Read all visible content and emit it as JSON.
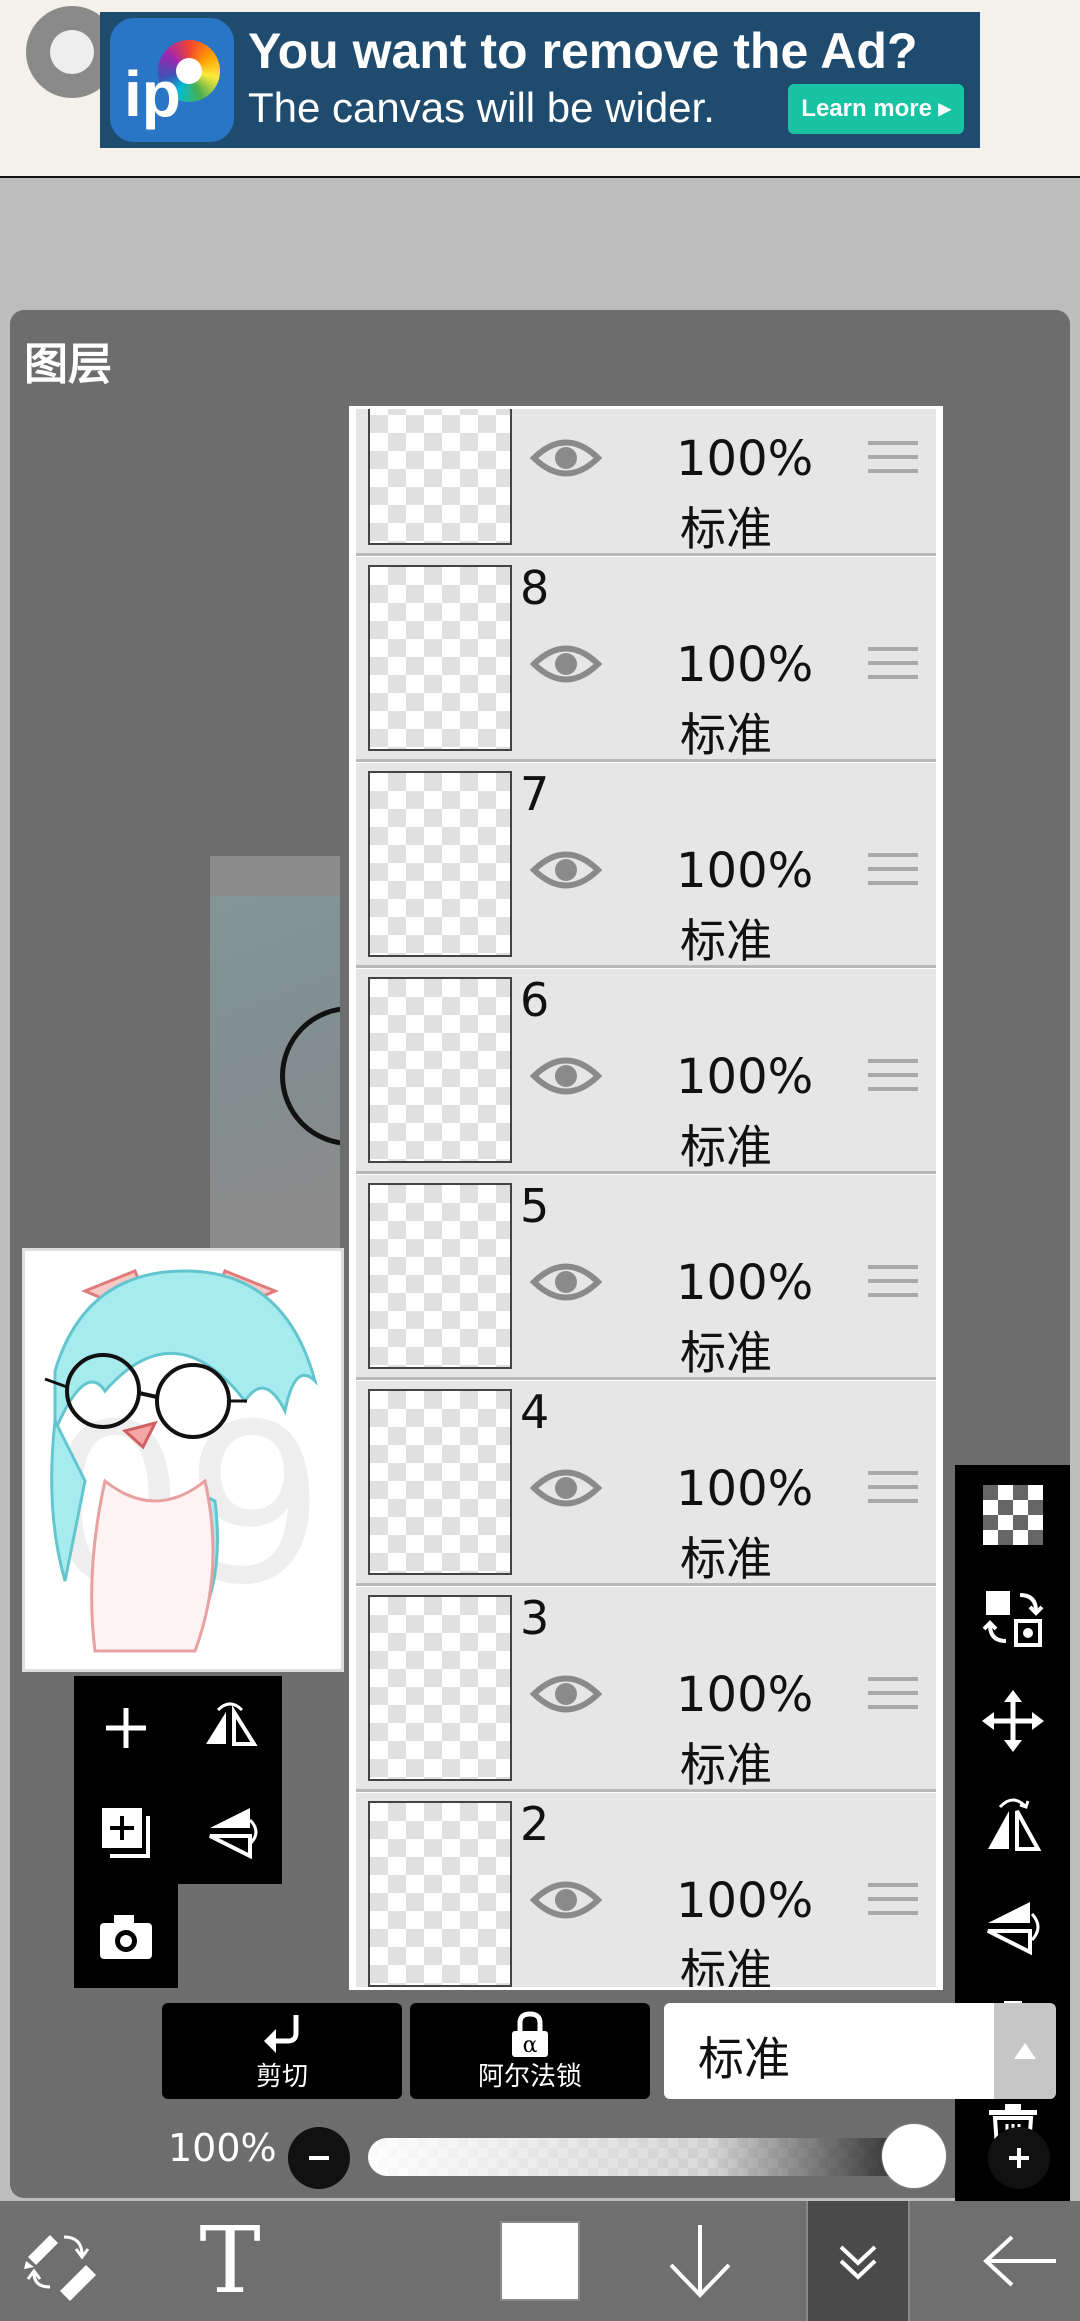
{
  "ad": {
    "title": "You want to remove the Ad?",
    "subtitle": "The canvas will be wider.",
    "cta": "Learn more ▸",
    "logo_text": "ip"
  },
  "panel": {
    "title": "图层"
  },
  "layers": [
    {
      "number": "",
      "opacity": "100%",
      "mode": "标准",
      "visible": true
    },
    {
      "number": "8",
      "opacity": "100%",
      "mode": "标准",
      "visible": true
    },
    {
      "number": "7",
      "opacity": "100%",
      "mode": "标准",
      "visible": true
    },
    {
      "number": "6",
      "opacity": "100%",
      "mode": "标准",
      "visible": true
    },
    {
      "number": "5",
      "opacity": "100%",
      "mode": "标准",
      "visible": true
    },
    {
      "number": "4",
      "opacity": "100%",
      "mode": "标准",
      "visible": true
    },
    {
      "number": "3",
      "opacity": "100%",
      "mode": "标准",
      "visible": true
    },
    {
      "number": "2",
      "opacity": "100%",
      "mode": "标准",
      "visible": true
    }
  ],
  "controls": {
    "clip_label": "剪切",
    "alpha_lock_label": "阿尔法锁",
    "blend_mode": "标准",
    "opacity_label": "100%",
    "opacity_value": 1.0
  },
  "icons": {
    "mini_tools": [
      "add-layer-icon",
      "flip-horizontal-icon",
      "duplicate-layer-icon",
      "flip-vertical-icon",
      "camera-icon"
    ],
    "right_tools": [
      "transparency-icon",
      "layer-swap-icon",
      "move-icon",
      "flip-horizontal-icon",
      "flip-vertical-icon",
      "merge-down-icon",
      "delete-icon",
      "more-icon"
    ],
    "bottom_bar": [
      "tools-icon",
      "text-icon",
      "color-icon",
      "download-icon",
      "collapse-icon",
      "back-icon"
    ]
  },
  "bottom_bar": {
    "text_tool_label": "T",
    "color": "#ffffff"
  }
}
